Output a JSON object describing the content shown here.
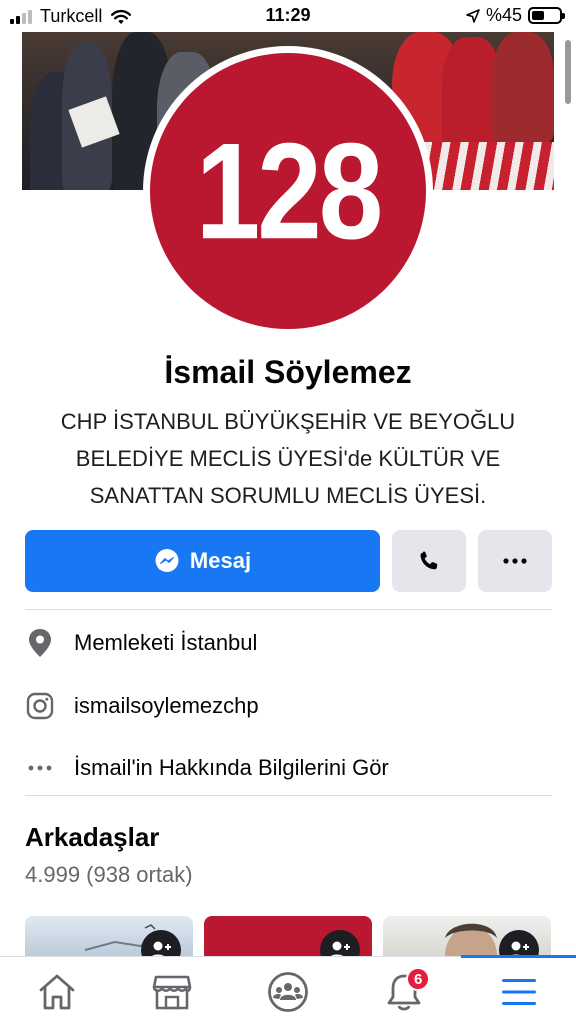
{
  "status_bar": {
    "carrier": "Turkcell",
    "time": "11:29",
    "battery": "%45",
    "battery_level": 0.45
  },
  "profile": {
    "picture_text": "128",
    "picture_color": "#ba1730",
    "name": "İsmail Söylemez",
    "bio": "CHP İSTANBUL BÜYÜKŞEHİR VE BEYOĞLU BELEDİYE MECLİS ÜYESİ'de KÜLTÜR VE SANATTAN SORUMLU MECLİS ÜYESİ."
  },
  "actions": {
    "message_label": "Mesaj",
    "message_icon": "messenger-icon",
    "call_icon": "phone-icon",
    "more_icon": "more-icon",
    "accent_color": "#1877f2"
  },
  "info": {
    "hometown": "Memleketi İstanbul",
    "instagram": "ismailsoylemezchp",
    "about_link": "İsmail'in Hakkında Bilgilerini Gör"
  },
  "friends": {
    "title": "Arkadaşlar",
    "count": "4.999 (938 ortak)"
  },
  "tabbar": {
    "items": [
      "home-icon",
      "marketplace-icon",
      "groups-icon",
      "notifications-icon",
      "menu-icon"
    ],
    "notification_badge": "6",
    "active": "menu-icon"
  }
}
